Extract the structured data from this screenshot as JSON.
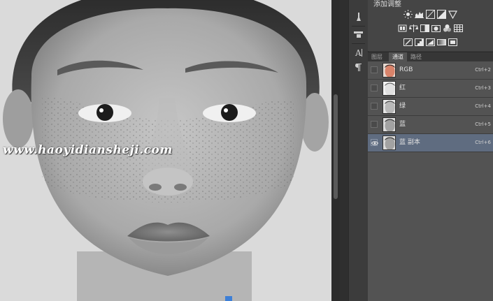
{
  "canvas": {
    "watermark": "www.haoyidiansheji.com"
  },
  "adjustments_panel": {
    "title": "添加调整",
    "icons_row1": [
      "brightness-contrast-icon",
      "levels-icon",
      "curves-icon",
      "exposure-icon",
      "vibrance-icon"
    ],
    "icons_row2": [
      "hue-saturation-icon",
      "color-balance-icon",
      "black-white-icon",
      "photo-filter-icon",
      "channel-mixer-icon",
      "color-lookup-icon"
    ],
    "icons_row3": [
      "invert-icon",
      "posterize-icon",
      "threshold-icon",
      "gradient-map-icon",
      "selective-color-icon"
    ]
  },
  "toolstrip": {
    "icons": [
      "brush-presets-icon",
      "clone-source-icon",
      "character-icon",
      "paragraph-icon"
    ]
  },
  "panel_tabs": [
    {
      "label": "图层",
      "active": false
    },
    {
      "label": "通道",
      "active": true
    },
    {
      "label": "路径",
      "active": false
    }
  ],
  "channels": [
    {
      "name": "RGB",
      "shortcut": "Ctrl+2",
      "thumb": "color",
      "selected": false
    },
    {
      "name": "红",
      "shortcut": "Ctrl+3",
      "thumb": "light",
      "selected": false
    },
    {
      "name": "绿",
      "shortcut": "Ctrl+4",
      "thumb": "mid",
      "selected": false
    },
    {
      "name": "蓝",
      "shortcut": "Ctrl+5",
      "thumb": "dark",
      "selected": false
    },
    {
      "name": "蓝 副本",
      "shortcut": "Ctrl+6",
      "thumb": "dark",
      "selected": true
    }
  ],
  "colors": {
    "selected_row": "#5f6c80",
    "panel_bg": "#535353",
    "canvas_bg": "#d9d9d9"
  }
}
